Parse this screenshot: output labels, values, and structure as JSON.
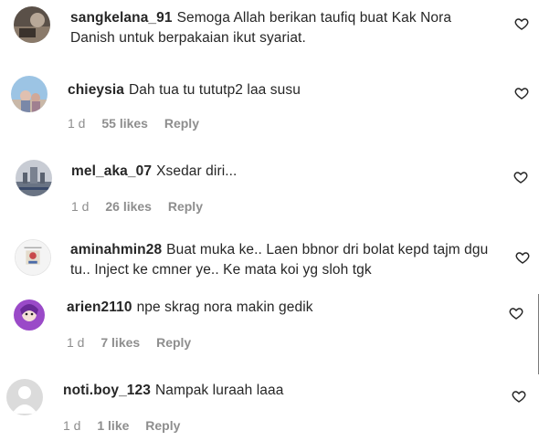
{
  "comments": [
    {
      "username": "sangkelana_91",
      "text": "Semoga Allah berikan taufiq buat Kak Nora Danish untuk berpakaian ikut syariat.",
      "time": "",
      "likes": "",
      "reply": "",
      "avatar": "dark-photo-avatar"
    },
    {
      "username": "chieysia",
      "text": "Dah tua tu tututp2 laa susu",
      "time": "1 d",
      "likes": "55 likes",
      "reply": "Reply",
      "avatar": "sky-photo-avatar"
    },
    {
      "username": "mel_aka_07",
      "text": "Xsedar diri...",
      "time": "1 d",
      "likes": "26 likes",
      "reply": "Reply",
      "avatar": "building-photo-avatar"
    },
    {
      "username": "aminahmin28",
      "text": "Buat muka ke.. Laen bbnor dri bolat kepd tajm dgu tu.. Inject ke cmner ye.. Ke mata koi yg sloh tgk",
      "time": "",
      "likes": "",
      "reply": "",
      "avatar": "logo-avatar"
    },
    {
      "username": "arien2110",
      "text": "npe skrag nora makin gedik",
      "time": "1 d",
      "likes": "7 likes",
      "reply": "Reply",
      "avatar": "purple-cartoon-avatar"
    },
    {
      "username": "noti.boy_123",
      "text": "Nampak luraah laaa",
      "time": "1 d",
      "likes": "1 like",
      "reply": "Reply",
      "avatar": "default-avatar"
    }
  ],
  "icons": {
    "like": "heart-outline-icon"
  },
  "colors": {
    "text": "#262626",
    "meta": "#8e8e8e",
    "background": "#ffffff"
  }
}
